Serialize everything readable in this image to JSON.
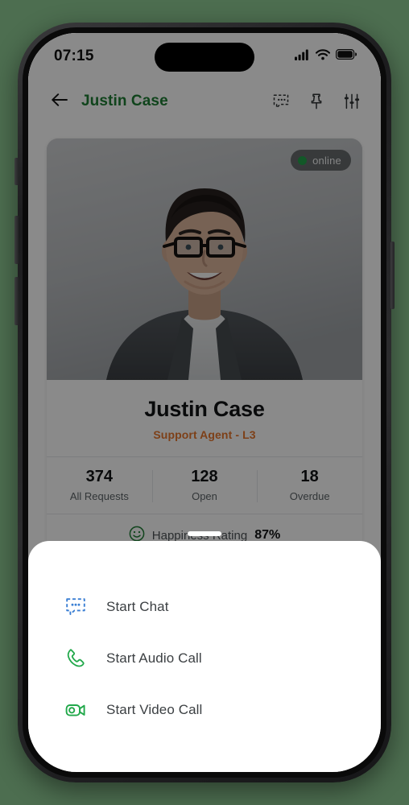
{
  "status_bar": {
    "time": "07:15",
    "icons": [
      "cellular-signal-icon",
      "wifi-icon",
      "battery-icon"
    ]
  },
  "nav_bar": {
    "back_icon": "arrow-left-icon",
    "title": "Justin Case",
    "actions": [
      {
        "name": "chat-bubble-icon",
        "label": "Chat"
      },
      {
        "name": "pin-icon",
        "label": "Pin"
      },
      {
        "name": "sliders-icon",
        "label": "Filters"
      }
    ]
  },
  "profile": {
    "photo_alt": "Justin Case portrait",
    "presence": {
      "status": "online",
      "dot_color": "#22a34a"
    },
    "name": "Justin Case",
    "role": "Support Agent - L3",
    "role_color": "#e8772e",
    "stats": [
      {
        "value": "374",
        "label": "All Requests"
      },
      {
        "value": "128",
        "label": "Open"
      },
      {
        "value": "18",
        "label": "Overdue"
      }
    ],
    "happiness": {
      "icon": "smiley-face-icon",
      "label": "Happiness Rating",
      "value": "87%"
    }
  },
  "bottom_sheet": {
    "handle": "sheet-drag-handle",
    "items": [
      {
        "icon": "chat-bubble-dots-icon",
        "label": "Start Chat",
        "color": "#3b7fd4"
      },
      {
        "icon": "phone-handset-icon",
        "label": "Start Audio Call",
        "color": "#21a84a"
      },
      {
        "icon": "video-camera-icon",
        "label": "Start Video Call",
        "color": "#21a84a"
      }
    ]
  },
  "theme": {
    "background": "#4d6e50",
    "accent_green": "#1e7e34",
    "accent_orange": "#e8772e",
    "blue": "#3b7fd4"
  }
}
